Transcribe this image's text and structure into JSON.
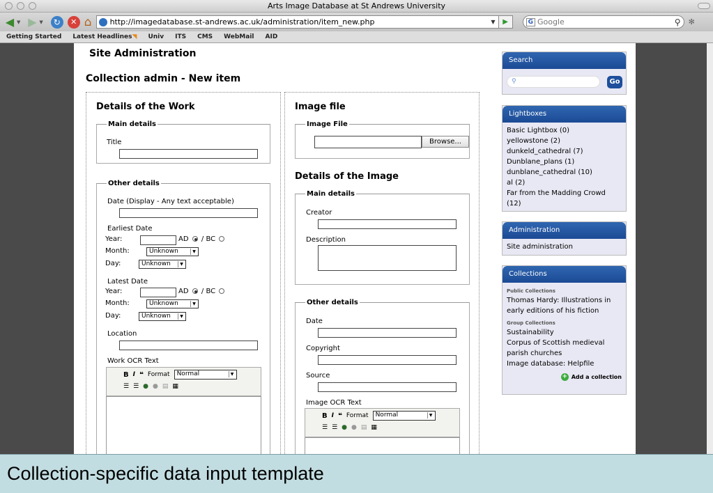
{
  "window": {
    "title": "Arts Image Database at St Andrews University"
  },
  "toolbar": {
    "url": "http://imagedatabase.st-andrews.ac.uk/administration/item_new.php",
    "search_placeholder": "Google",
    "search_engine_badge": "G"
  },
  "bookmarks": [
    "Getting Started",
    "Latest Headlines",
    "Univ",
    "ITS",
    "CMS",
    "WebMail",
    "AID"
  ],
  "page": {
    "site_admin": "Site Administration",
    "collection_admin": "Collection admin - New item"
  },
  "work": {
    "heading": "Details of the Work",
    "main_legend": "Main details",
    "title_label": "Title",
    "other_legend": "Other details",
    "date_label": "Date (Display - Any text acceptable)",
    "earliest_label": "Earliest Date",
    "latest_label": "Latest Date",
    "year_label": "Year:",
    "ad_label": "AD",
    "bc_label": "/ BC",
    "month_label": "Month:",
    "day_label": "Day:",
    "unknown": "Unknown",
    "location_label": "Location",
    "ocr_label": "Work OCR Text",
    "format_label": "Format",
    "format_value": "Normal"
  },
  "image": {
    "file_heading": "Image file",
    "file_legend": "Image File",
    "browse": "Browse...",
    "details_heading": "Details of the Image",
    "main_legend": "Main details",
    "creator_label": "Creator",
    "description_label": "Description",
    "other_legend": "Other details",
    "date_label": "Date",
    "copyright_label": "Copyright",
    "source_label": "Source",
    "ocr_label": "Image OCR Text",
    "format_label": "Format",
    "format_value": "Normal"
  },
  "sidebar": {
    "search_title": "Search",
    "go": "Go",
    "lightboxes_title": "Lightboxes",
    "lightboxes": [
      "Basic Lightbox (0)",
      "yellowstone (2)",
      "dunkeld_cathedral (7)",
      "Dunblane_plans (1)",
      "dunblane_cathedral (10)",
      "al (2)",
      "Far from the Madding Crowd (12)"
    ],
    "admin_title": "Administration",
    "admin_link": "Site administration",
    "collections_title": "Collections",
    "public_label": "Public Collections",
    "public_items": [
      "Thomas Hardy: Illustrations in early editions of his fiction"
    ],
    "group_label": "Group Collections",
    "group_items": [
      "Sustainability",
      "Corpus of Scottish medieval parish churches",
      "Image database: Helpfile"
    ],
    "add_collection": "Add a collection"
  },
  "caption": "Collection-specific data input template"
}
